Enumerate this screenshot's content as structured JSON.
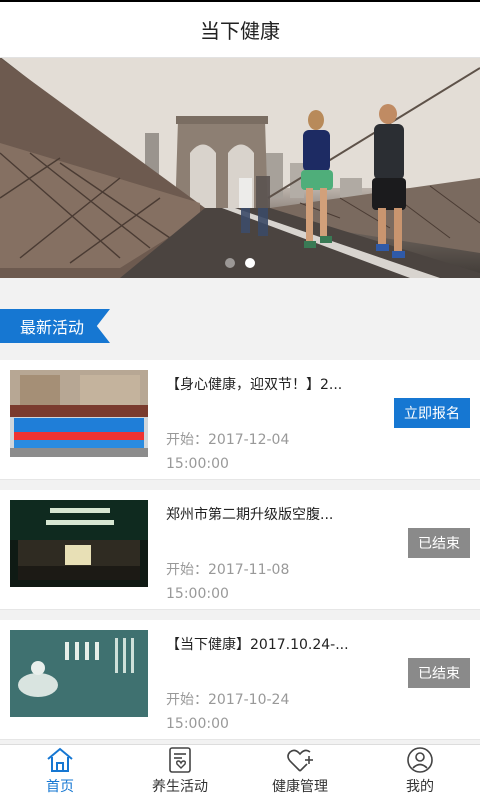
{
  "header": {
    "title": "当下健康"
  },
  "banner": {
    "slides": 2,
    "active_index": 1
  },
  "section": {
    "label": "最新活动"
  },
  "activities": [
    {
      "title": "【身心健康，迎双节！】2...",
      "date_prefix": "开始：",
      "date": "2017-12-04",
      "time": "15:00:00",
      "button": "立即报名",
      "status": "open"
    },
    {
      "title": "郑州市第二期升级版空腹...",
      "date_prefix": "开始：",
      "date": "2017-11-08",
      "time": "15:00:00",
      "button": "已结束",
      "status": "ended"
    },
    {
      "title": "【当下健康】2017.10.24-...",
      "date_prefix": "开始：",
      "date": "2017-10-24",
      "time": "15:00:00",
      "button": "已结束",
      "status": "ended"
    }
  ],
  "tabs": [
    {
      "label": "首页",
      "icon": "home-icon",
      "active": true
    },
    {
      "label": "养生活动",
      "icon": "calendar-heart-icon",
      "active": false
    },
    {
      "label": "健康管理",
      "icon": "heart-plus-icon",
      "active": false
    },
    {
      "label": "我的",
      "icon": "user-icon",
      "active": false
    }
  ],
  "colors": {
    "accent": "#1677d2",
    "ended": "#8a8a8a"
  }
}
